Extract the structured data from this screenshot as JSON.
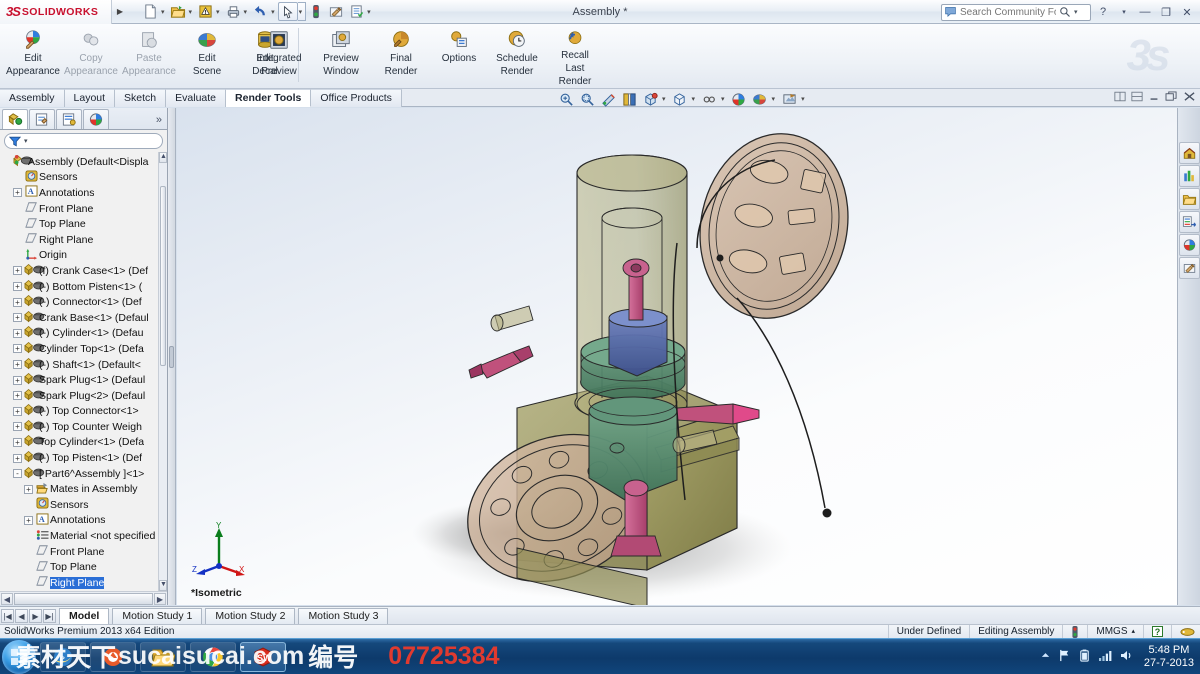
{
  "app": {
    "brand_ds": "3S",
    "brand_name": "SOLIDWORKS",
    "document_title": "Assembly *",
    "edition": "SolidWorks Premium 2013 x64 Edition"
  },
  "search": {
    "placeholder": "Search Community Forum",
    "value": ""
  },
  "window_buttons": {
    "help": "?",
    "help_caret": "▾",
    "minimize": "—",
    "restore": "❐",
    "close": "✕"
  },
  "quick_access": [
    {
      "name": "new-document",
      "glyph": "📄",
      "has_dropdown": true
    },
    {
      "name": "open-document",
      "glyph": "📂",
      "has_dropdown": true
    },
    {
      "name": "rebuild",
      "glyph": "⚠",
      "has_dropdown": true
    },
    {
      "name": "print",
      "glyph": "🖨",
      "has_dropdown": true
    },
    {
      "name": "undo",
      "glyph": "↶",
      "has_dropdown": true
    },
    {
      "name": "select",
      "glyph": "↖",
      "has_dropdown": true
    },
    {
      "name": "rebuild-status",
      "glyph": "🚦",
      "has_dropdown": false
    },
    {
      "name": "options",
      "glyph": "📝",
      "has_dropdown": false
    },
    {
      "name": "customize",
      "glyph": "📋",
      "has_dropdown": true
    }
  ],
  "ribbon": {
    "group_appearance": [
      {
        "label_line1": "Edit",
        "label_line2": "Appearance",
        "icon": "edit-appearance-icon",
        "enabled": true
      },
      {
        "label_line1": "Copy",
        "label_line2": "Appearance",
        "icon": "copy-appearance-icon",
        "enabled": false
      },
      {
        "label_line1": "Paste",
        "label_line2": "Appearance",
        "icon": "paste-appearance-icon",
        "enabled": false
      },
      {
        "label_line1": "Edit",
        "label_line2": "Scene",
        "icon": "edit-scene-icon",
        "enabled": true
      },
      {
        "label_line1": "Edit",
        "label_line2": "Decal",
        "icon": "edit-decal-icon",
        "enabled": true
      }
    ],
    "group_render": [
      {
        "label_line1": "Integrated",
        "label_line2": "Preview",
        "icon": "integrated-preview-icon",
        "enabled": true
      },
      {
        "label_line1": "Preview",
        "label_line2": "Window",
        "icon": "preview-window-icon",
        "enabled": true
      },
      {
        "label_line1": "Final",
        "label_line2": "Render",
        "icon": "final-render-icon",
        "enabled": true
      },
      {
        "label_line1": "Options",
        "label_line2": "",
        "icon": "render-options-icon",
        "enabled": true
      },
      {
        "label_line1": "Schedule",
        "label_line2": "Render",
        "icon": "schedule-render-icon",
        "enabled": true
      },
      {
        "label_line1": "Recall",
        "label_line2": "Last",
        "label_line3": "Render",
        "icon": "recall-last-render-icon",
        "enabled": true
      }
    ]
  },
  "command_tabs": [
    {
      "label": "Assembly",
      "active": false
    },
    {
      "label": "Layout",
      "active": false
    },
    {
      "label": "Sketch",
      "active": false
    },
    {
      "label": "Evaluate",
      "active": false
    },
    {
      "label": "Render Tools",
      "active": true
    },
    {
      "label": "Office Products",
      "active": false
    }
  ],
  "view_toolbar": [
    {
      "name": "zoom-to-fit-icon",
      "dropdown": false
    },
    {
      "name": "zoom-to-area-icon",
      "dropdown": false
    },
    {
      "name": "section-view-icon",
      "dropdown": false
    },
    {
      "name": "view-orientation-icon",
      "dropdown": false
    },
    {
      "name": "display-style-icon",
      "dropdown": true
    },
    {
      "name": "hide-show-items-icon",
      "dropdown": true
    },
    {
      "name": "edit-appearance-small-icon",
      "dropdown": true
    },
    {
      "name": "apply-scene-icon",
      "dropdown": true
    },
    {
      "name": "view-settings-icon",
      "dropdown": true
    },
    {
      "name": "display-states-icon",
      "dropdown": true
    }
  ],
  "window_tile_buttons": [
    "split-horizontal-icon",
    "split-vertical-icon",
    "minimize-doc",
    "restore-doc",
    "close-doc"
  ],
  "feature_manager": {
    "tabs": [
      {
        "name": "feature-manager-design-tree-tab",
        "active": true
      },
      {
        "name": "property-manager-tab",
        "active": false
      },
      {
        "name": "configuration-manager-tab",
        "active": false
      },
      {
        "name": "display-manager-tab",
        "active": false
      }
    ],
    "more_tabs": "»",
    "filter_placeholder": "",
    "tree": [
      {
        "label": "Assembly  (Default<Displa",
        "icon": "assembly-icon",
        "depth": 0,
        "expander": "",
        "selected": false
      },
      {
        "label": "Sensors",
        "icon": "sensors-icon",
        "depth": 1,
        "expander": "",
        "selected": false
      },
      {
        "label": "Annotations",
        "icon": "annotations-icon",
        "depth": 1,
        "expander": "+",
        "selected": false
      },
      {
        "label": "Front Plane",
        "icon": "plane-icon",
        "depth": 1,
        "expander": "",
        "selected": false
      },
      {
        "label": "Top Plane",
        "icon": "plane-icon",
        "depth": 1,
        "expander": "",
        "selected": false
      },
      {
        "label": "Right Plane",
        "icon": "plane-icon",
        "depth": 1,
        "expander": "",
        "selected": false
      },
      {
        "label": "Origin",
        "icon": "origin-icon",
        "depth": 1,
        "expander": "",
        "selected": false
      },
      {
        "label": "(f) Crank Case<1> (Def",
        "icon": "component-icon",
        "depth": 1,
        "expander": "+",
        "selected": false
      },
      {
        "label": "(-) Bottom Pisten<1> (",
        "icon": "component-icon",
        "depth": 1,
        "expander": "+",
        "selected": false
      },
      {
        "label": "(-) Connector<1> (Def",
        "icon": "component-icon",
        "depth": 1,
        "expander": "+",
        "selected": false
      },
      {
        "label": "Crank Base<1> (Defaul",
        "icon": "component-icon",
        "depth": 1,
        "expander": "+",
        "selected": false
      },
      {
        "label": "(-) Cylinder<1> (Defau",
        "icon": "component-icon",
        "depth": 1,
        "expander": "+",
        "selected": false
      },
      {
        "label": "Cylinder Top<1> (Defa",
        "icon": "component-icon",
        "depth": 1,
        "expander": "+",
        "selected": false
      },
      {
        "label": "(-) Shaft<1> (Default<",
        "icon": "component-icon",
        "depth": 1,
        "expander": "+",
        "selected": false
      },
      {
        "label": "Spark Plug<1> (Defaul",
        "icon": "component-icon",
        "depth": 1,
        "expander": "+",
        "selected": false
      },
      {
        "label": "Spark Plug<2> (Defaul",
        "icon": "component-icon",
        "depth": 1,
        "expander": "+",
        "selected": false
      },
      {
        "label": "(-) Top Connector<1>",
        "icon": "component-icon",
        "depth": 1,
        "expander": "+",
        "selected": false
      },
      {
        "label": "(-) Top Counter Weigh",
        "icon": "component-icon",
        "depth": 1,
        "expander": "+",
        "selected": false
      },
      {
        "label": "Top Cylinder<1> (Defa",
        "icon": "component-icon",
        "depth": 1,
        "expander": "+",
        "selected": false
      },
      {
        "label": "(-) Top Pisten<1> (Def",
        "icon": "component-icon",
        "depth": 1,
        "expander": "+",
        "selected": false
      },
      {
        "label": "[ Part6^Assembly ]<1>",
        "icon": "component-icon",
        "depth": 1,
        "expander": "-",
        "selected": false
      },
      {
        "label": "Mates in Assembly",
        "icon": "mates-icon",
        "depth": 2,
        "expander": "+",
        "selected": false
      },
      {
        "label": "Sensors",
        "icon": "sensors-icon",
        "depth": 2,
        "expander": "",
        "selected": false
      },
      {
        "label": "Annotations",
        "icon": "annotations-icon",
        "depth": 2,
        "expander": "+",
        "selected": false
      },
      {
        "label": "Material <not specified",
        "icon": "material-icon",
        "depth": 2,
        "expander": "",
        "selected": false
      },
      {
        "label": "Front Plane",
        "icon": "plane-icon",
        "depth": 2,
        "expander": "",
        "selected": false
      },
      {
        "label": "Top Plane",
        "icon": "plane-icon",
        "depth": 2,
        "expander": "",
        "selected": false
      },
      {
        "label": "Right Plane",
        "icon": "plane-icon",
        "depth": 2,
        "expander": "",
        "selected": true
      }
    ]
  },
  "task_pane": [
    {
      "name": "solidworks-resources-icon"
    },
    {
      "name": "design-library-icon"
    },
    {
      "name": "file-explorer-icon"
    },
    {
      "name": "view-palette-icon"
    },
    {
      "name": "appearances-scenes-decals-icon"
    },
    {
      "name": "custom-properties-icon"
    }
  ],
  "graphics": {
    "view_label": "*Isometric",
    "triad_axes": [
      {
        "name": "y-axis",
        "label": "Y",
        "color": "#0a7d1c"
      },
      {
        "name": "x-axis",
        "label": "X",
        "color": "#d01515"
      },
      {
        "name": "z-axis",
        "label": "Z",
        "color": "#1431c4"
      }
    ],
    "model_colors": {
      "crank_case": "#8d8a52",
      "flywheel": "#c3a78e",
      "cylinder": "#4f8a6b",
      "piston_blue": "#4a5f9e",
      "rod_pink": "#c0517c",
      "shadow": "#9a9a9a"
    }
  },
  "bottom_tabs": {
    "nav": [
      "|◀",
      "◀",
      "▶",
      "▶|"
    ],
    "tabs": [
      {
        "label": "Model",
        "active": true
      },
      {
        "label": "Motion Study 1",
        "active": false
      },
      {
        "label": "Motion Study 2",
        "active": false
      },
      {
        "label": "Motion Study 3",
        "active": false
      }
    ]
  },
  "status_bar": {
    "left": "SolidWorks Premium 2013 x64 Edition",
    "under_defined": "Under Defined",
    "editing": "Editing Assembly",
    "units": "MMGS",
    "units_caret": "▴",
    "help_badge": "?",
    "rebuild_icon": "rebuild-status-icon",
    "tag_icon": "tag-icon"
  },
  "taskbar": {
    "start": "start-orb",
    "items": [
      {
        "name": "internet-explorer-taskbar-item",
        "icon": "internet-explorer-icon",
        "active": false
      },
      {
        "name": "browser2-taskbar-item",
        "icon": "browser-icon",
        "active": false
      },
      {
        "name": "explorer-taskbar-item",
        "icon": "folder-icon",
        "active": false
      },
      {
        "name": "chrome-taskbar-item",
        "icon": "chrome-icon",
        "active": false
      },
      {
        "name": "solidworks-taskbar-item",
        "icon": "solidworks-icon",
        "active": true
      }
    ],
    "tray": [
      "show-hidden-icons",
      "action-center-icon",
      "battery-icon",
      "network-icon",
      "volume-icon"
    ],
    "clock_time": "5:48 PM",
    "clock_date": "27-7-2013",
    "watermark_cn": "素材天下",
    "watermark_site": "sucaisucai.com",
    "watermark_cn2": "编号",
    "watermark_number": "07725384"
  }
}
